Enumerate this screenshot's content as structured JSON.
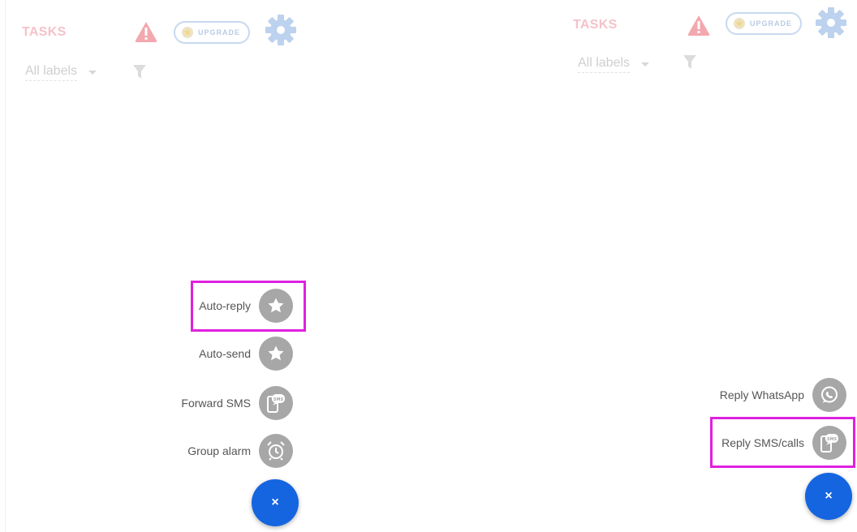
{
  "left_screen": {
    "header": {
      "title": "TASKS",
      "upgrade_label": "UPGRADE"
    },
    "filter": {
      "selected_label": "All labels"
    },
    "fab_menu": [
      {
        "label": "Auto-reply",
        "icon": "star-icon",
        "highlighted": true
      },
      {
        "label": "Auto-send",
        "icon": "star-icon",
        "highlighted": false
      },
      {
        "label": "Forward SMS",
        "icon": "sms-phone-icon",
        "highlighted": false
      },
      {
        "label": "Group alarm",
        "icon": "alarm-clock-icon",
        "highlighted": false
      }
    ],
    "close_fab_glyph": "×"
  },
  "right_screen": {
    "header": {
      "title": "TASKS",
      "upgrade_label": "UPGRADE"
    },
    "filter": {
      "selected_label": "All labels"
    },
    "fab_menu": [
      {
        "label": "Reply WhatsApp",
        "icon": "whatsapp-icon",
        "highlighted": false
      },
      {
        "label": "Reply SMS/calls",
        "icon": "sms-phone-icon",
        "highlighted": true
      }
    ],
    "close_fab_glyph": "×"
  },
  "colors": {
    "highlight": "#e020e0",
    "fab_blue": "#1565e0",
    "mini_fab_gray": "#a7a7a7",
    "title_faded_red": "#f6c2c9",
    "accent_faded_blue": "#c7d9f0"
  }
}
